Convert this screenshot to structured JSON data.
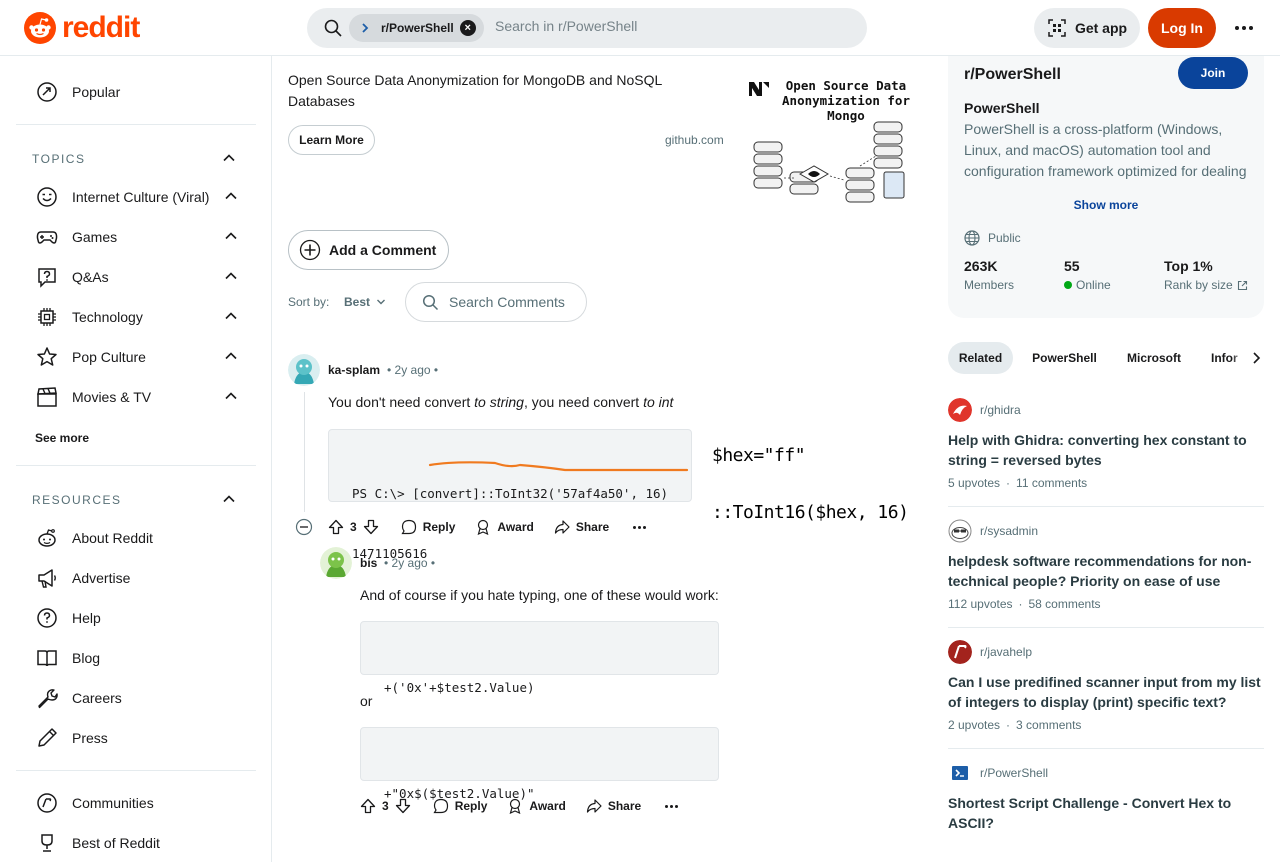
{
  "header": {
    "logo_text": "reddit",
    "search_chip": "r/PowerShell",
    "search_placeholder": "Search in r/PowerShell",
    "get_app": "Get app",
    "login": "Log In"
  },
  "sidebar": {
    "popular": "Popular",
    "topics_title": "TOPICS",
    "topics": [
      {
        "label": "Internet Culture (Viral)",
        "icon": "smile-face-icon"
      },
      {
        "label": "Games",
        "icon": "gamepad-icon"
      },
      {
        "label": "Q&As",
        "icon": "question-icon"
      },
      {
        "label": "Technology",
        "icon": "chip-icon"
      },
      {
        "label": "Pop Culture",
        "icon": "star-icon"
      },
      {
        "label": "Movies & TV",
        "icon": "clapper-icon"
      }
    ],
    "see_more": "See more",
    "resources_title": "RESOURCES",
    "resources": [
      {
        "label": "About Reddit",
        "icon": "reddit-alien-icon"
      },
      {
        "label": "Advertise",
        "icon": "megaphone-icon"
      },
      {
        "label": "Help",
        "icon": "help-icon"
      },
      {
        "label": "Blog",
        "icon": "book-icon"
      },
      {
        "label": "Careers",
        "icon": "wrench-icon"
      },
      {
        "label": "Press",
        "icon": "pen-icon"
      }
    ],
    "communities": "Communities",
    "best_of": "Best of Reddit"
  },
  "ad": {
    "text": "Open Source Data Anonymization for MongoDB and NoSQL Databases",
    "learn_more": "Learn More",
    "domain": "github.com",
    "image_title": "Open Source Data Anonymization for Mongo"
  },
  "comments_controls": {
    "add_comment": "Add a Comment",
    "sort_by": "Sort by:",
    "sort_value": "Best",
    "search_comments": "Search Comments"
  },
  "comments": [
    {
      "author": "ka-splam",
      "time": "• 2y ago •",
      "text_a": "You don't need convert ",
      "text_b": "to string",
      "text_c": ", you need convert ",
      "text_d": "to int",
      "code_line1": "PS C:\\> [convert]::ToInt32('57af4a50', 16)",
      "code_line2": "1471105616",
      "handwritten_line1": "$hex=\"ff\"",
      "handwritten_line2": "::ToInt16($hex, 16)",
      "votes": "3",
      "reply": "Reply",
      "award": "Award",
      "share": "Share"
    },
    {
      "author": "bis",
      "time": "• 2y ago •",
      "text": "And of course if you hate typing, one of these would work:",
      "code1": "+('0x'+$test2.Value)",
      "or": "or",
      "code2": "+\"0x$($test2.Value)\"",
      "votes": "3",
      "reply": "Reply",
      "award": "Award",
      "share": "Share"
    }
  ],
  "community_card": {
    "name": "r/PowerShell",
    "join": "Join",
    "title": "PowerShell",
    "description": "PowerShell is a cross-platform (Windows, Linux, and macOS) automation tool and configuration framework optimized for dealing with structured data",
    "show_more": "Show more",
    "visibility": "Public",
    "members_value": "263K",
    "members_label": "Members",
    "online_value": "55",
    "online_label": "Online",
    "rank_value": "Top 1%",
    "rank_label": "Rank by size"
  },
  "related": {
    "tabs": [
      "Related",
      "PowerShell",
      "Microsoft",
      "Infor"
    ],
    "posts": [
      {
        "sub": "r/ghidra",
        "title": "Help with Ghidra: converting hex constant to string = reversed bytes",
        "upvotes": "5 upvotes",
        "comments": "11 comments"
      },
      {
        "sub": "r/sysadmin",
        "title": "helpdesk software recommendations for non-technical people? Priority on ease of use",
        "upvotes": "112 upvotes",
        "comments": "58 comments"
      },
      {
        "sub": "r/javahelp",
        "title": "Can I use predifined scanner input from my list of integers to display (print) specific text?",
        "upvotes": "2 upvotes",
        "comments": "3 comments"
      },
      {
        "sub": "r/PowerShell",
        "title": "Shortest Script Challenge - Convert Hex to ASCII?",
        "upvotes": "",
        "comments": ""
      }
    ]
  },
  "colors": {
    "brand": "#ff4500",
    "login": "#d93a00",
    "join": "#0a449b",
    "online": "#01a816",
    "annotation": "#f07a1f"
  }
}
